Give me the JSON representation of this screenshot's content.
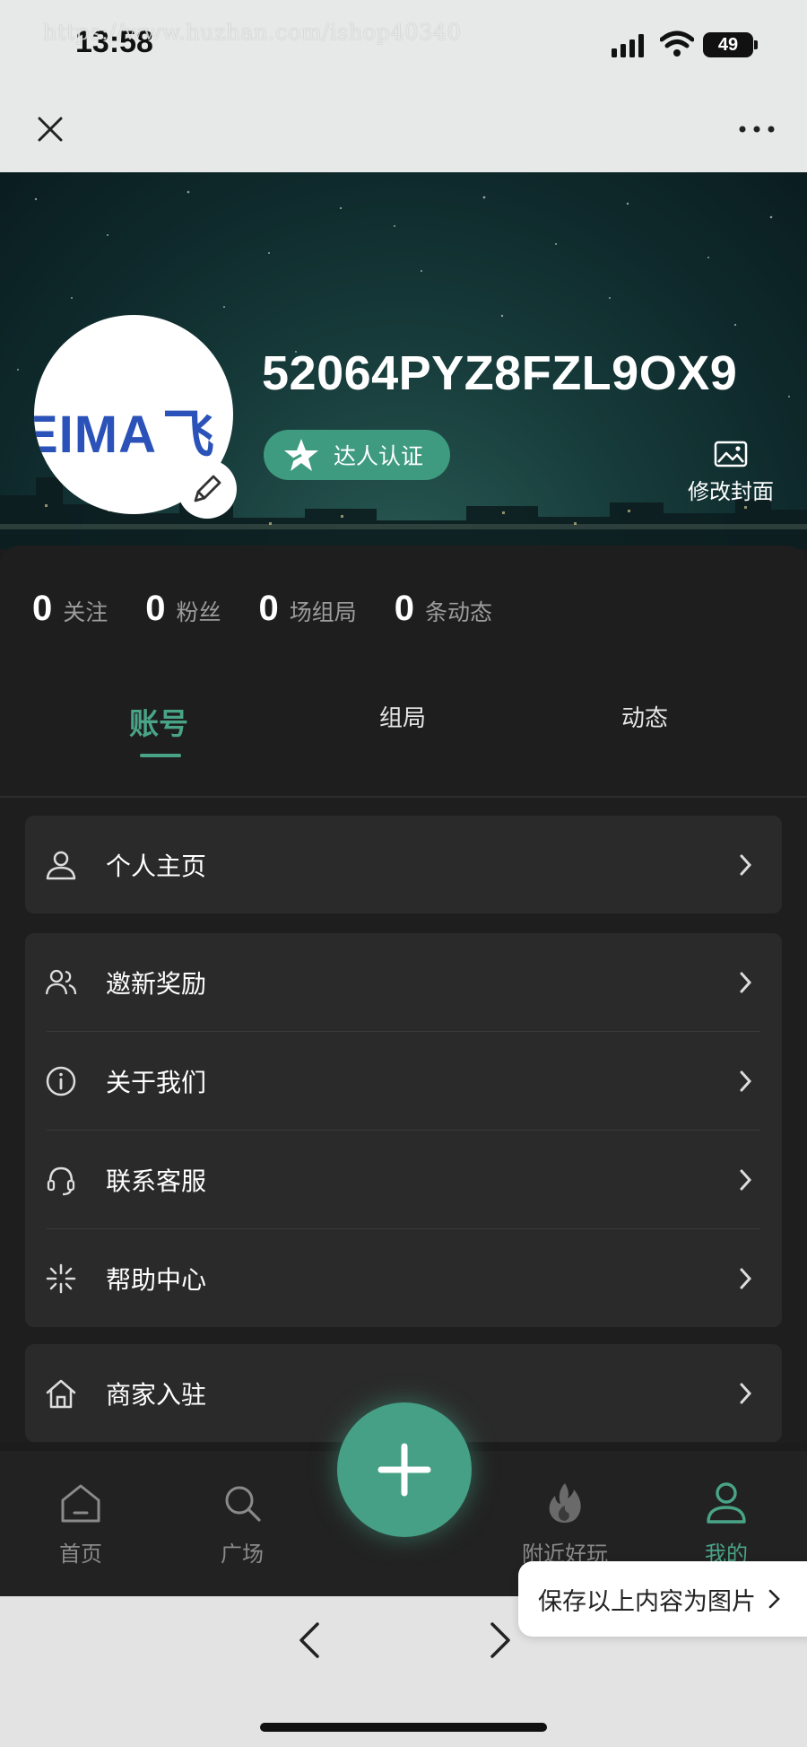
{
  "watermark": "https://www.huzhan.com/ishop40340",
  "status_bar": {
    "time": "13:58",
    "battery": "49"
  },
  "profile": {
    "avatar_logo_blue_1": "EIMA",
    "avatar_logo_orange": "",
    "avatar_logo_blue_2": "飞",
    "username": "52064PYZ8FZL9OX9",
    "badge_label": "达人认证",
    "cover_edit_label": "修改封面"
  },
  "stats": [
    {
      "num": "0",
      "label": "关注"
    },
    {
      "num": "0",
      "label": "粉丝"
    },
    {
      "num": "0",
      "label": "场组局"
    },
    {
      "num": "0",
      "label": "条动态"
    }
  ],
  "tabs": {
    "account": "账号",
    "group": "组局",
    "moments": "动态"
  },
  "menu": {
    "homepage": "个人主页",
    "invite": "邀新奖励",
    "about": "关于我们",
    "service": "联系客服",
    "help": "帮助中心",
    "merchant": "商家入驻"
  },
  "tabbar": {
    "home": "首页",
    "plaza": "广场",
    "nearby": "附近好玩",
    "mine": "我的"
  },
  "save_tip": "保存以上内容为图片",
  "colors": {
    "accent": "#49a487",
    "panel": "#1e1e1e",
    "card": "#2a2a2a"
  },
  "icons": [
    "close-icon",
    "more-icon",
    "pencil-icon",
    "star-badge-icon",
    "image-icon",
    "person-icon",
    "users-icon",
    "info-icon",
    "headset-icon",
    "sparkle-icon",
    "house-icon",
    "chevron-right-icon",
    "home-icon",
    "search-icon",
    "plus-icon",
    "fire-icon",
    "user-icon",
    "back-icon",
    "forward-icon"
  ]
}
